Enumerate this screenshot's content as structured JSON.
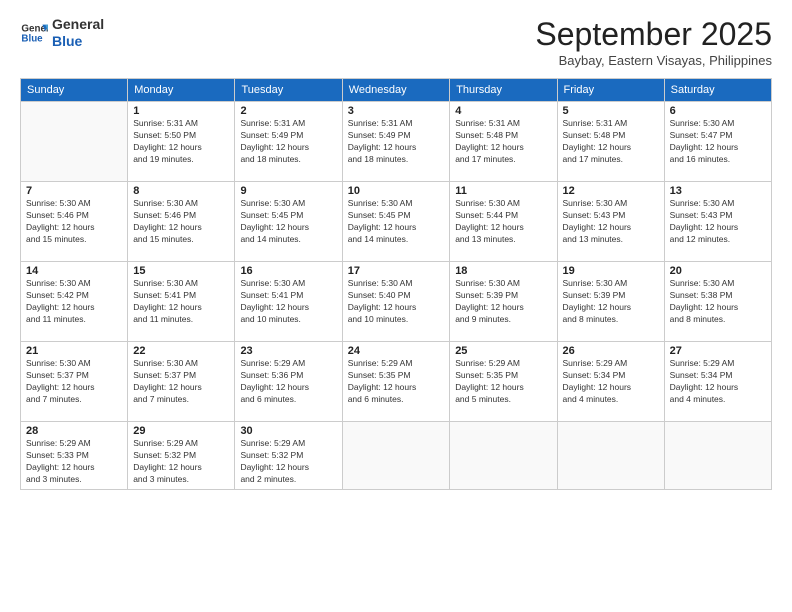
{
  "logo": {
    "line1": "General",
    "line2": "Blue"
  },
  "header": {
    "month": "September 2025",
    "location": "Baybay, Eastern Visayas, Philippines"
  },
  "weekdays": [
    "Sunday",
    "Monday",
    "Tuesday",
    "Wednesday",
    "Thursday",
    "Friday",
    "Saturday"
  ],
  "weeks": [
    [
      {
        "day": "",
        "info": ""
      },
      {
        "day": "1",
        "info": "Sunrise: 5:31 AM\nSunset: 5:50 PM\nDaylight: 12 hours\nand 19 minutes."
      },
      {
        "day": "2",
        "info": "Sunrise: 5:31 AM\nSunset: 5:49 PM\nDaylight: 12 hours\nand 18 minutes."
      },
      {
        "day": "3",
        "info": "Sunrise: 5:31 AM\nSunset: 5:49 PM\nDaylight: 12 hours\nand 18 minutes."
      },
      {
        "day": "4",
        "info": "Sunrise: 5:31 AM\nSunset: 5:48 PM\nDaylight: 12 hours\nand 17 minutes."
      },
      {
        "day": "5",
        "info": "Sunrise: 5:31 AM\nSunset: 5:48 PM\nDaylight: 12 hours\nand 17 minutes."
      },
      {
        "day": "6",
        "info": "Sunrise: 5:30 AM\nSunset: 5:47 PM\nDaylight: 12 hours\nand 16 minutes."
      }
    ],
    [
      {
        "day": "7",
        "info": "Sunrise: 5:30 AM\nSunset: 5:46 PM\nDaylight: 12 hours\nand 15 minutes."
      },
      {
        "day": "8",
        "info": "Sunrise: 5:30 AM\nSunset: 5:46 PM\nDaylight: 12 hours\nand 15 minutes."
      },
      {
        "day": "9",
        "info": "Sunrise: 5:30 AM\nSunset: 5:45 PM\nDaylight: 12 hours\nand 14 minutes."
      },
      {
        "day": "10",
        "info": "Sunrise: 5:30 AM\nSunset: 5:45 PM\nDaylight: 12 hours\nand 14 minutes."
      },
      {
        "day": "11",
        "info": "Sunrise: 5:30 AM\nSunset: 5:44 PM\nDaylight: 12 hours\nand 13 minutes."
      },
      {
        "day": "12",
        "info": "Sunrise: 5:30 AM\nSunset: 5:43 PM\nDaylight: 12 hours\nand 13 minutes."
      },
      {
        "day": "13",
        "info": "Sunrise: 5:30 AM\nSunset: 5:43 PM\nDaylight: 12 hours\nand 12 minutes."
      }
    ],
    [
      {
        "day": "14",
        "info": "Sunrise: 5:30 AM\nSunset: 5:42 PM\nDaylight: 12 hours\nand 11 minutes."
      },
      {
        "day": "15",
        "info": "Sunrise: 5:30 AM\nSunset: 5:41 PM\nDaylight: 12 hours\nand 11 minutes."
      },
      {
        "day": "16",
        "info": "Sunrise: 5:30 AM\nSunset: 5:41 PM\nDaylight: 12 hours\nand 10 minutes."
      },
      {
        "day": "17",
        "info": "Sunrise: 5:30 AM\nSunset: 5:40 PM\nDaylight: 12 hours\nand 10 minutes."
      },
      {
        "day": "18",
        "info": "Sunrise: 5:30 AM\nSunset: 5:39 PM\nDaylight: 12 hours\nand 9 minutes."
      },
      {
        "day": "19",
        "info": "Sunrise: 5:30 AM\nSunset: 5:39 PM\nDaylight: 12 hours\nand 8 minutes."
      },
      {
        "day": "20",
        "info": "Sunrise: 5:30 AM\nSunset: 5:38 PM\nDaylight: 12 hours\nand 8 minutes."
      }
    ],
    [
      {
        "day": "21",
        "info": "Sunrise: 5:30 AM\nSunset: 5:37 PM\nDaylight: 12 hours\nand 7 minutes."
      },
      {
        "day": "22",
        "info": "Sunrise: 5:30 AM\nSunset: 5:37 PM\nDaylight: 12 hours\nand 7 minutes."
      },
      {
        "day": "23",
        "info": "Sunrise: 5:29 AM\nSunset: 5:36 PM\nDaylight: 12 hours\nand 6 minutes."
      },
      {
        "day": "24",
        "info": "Sunrise: 5:29 AM\nSunset: 5:35 PM\nDaylight: 12 hours\nand 6 minutes."
      },
      {
        "day": "25",
        "info": "Sunrise: 5:29 AM\nSunset: 5:35 PM\nDaylight: 12 hours\nand 5 minutes."
      },
      {
        "day": "26",
        "info": "Sunrise: 5:29 AM\nSunset: 5:34 PM\nDaylight: 12 hours\nand 4 minutes."
      },
      {
        "day": "27",
        "info": "Sunrise: 5:29 AM\nSunset: 5:34 PM\nDaylight: 12 hours\nand 4 minutes."
      }
    ],
    [
      {
        "day": "28",
        "info": "Sunrise: 5:29 AM\nSunset: 5:33 PM\nDaylight: 12 hours\nand 3 minutes."
      },
      {
        "day": "29",
        "info": "Sunrise: 5:29 AM\nSunset: 5:32 PM\nDaylight: 12 hours\nand 3 minutes."
      },
      {
        "day": "30",
        "info": "Sunrise: 5:29 AM\nSunset: 5:32 PM\nDaylight: 12 hours\nand 2 minutes."
      },
      {
        "day": "",
        "info": ""
      },
      {
        "day": "",
        "info": ""
      },
      {
        "day": "",
        "info": ""
      },
      {
        "day": "",
        "info": ""
      }
    ]
  ]
}
